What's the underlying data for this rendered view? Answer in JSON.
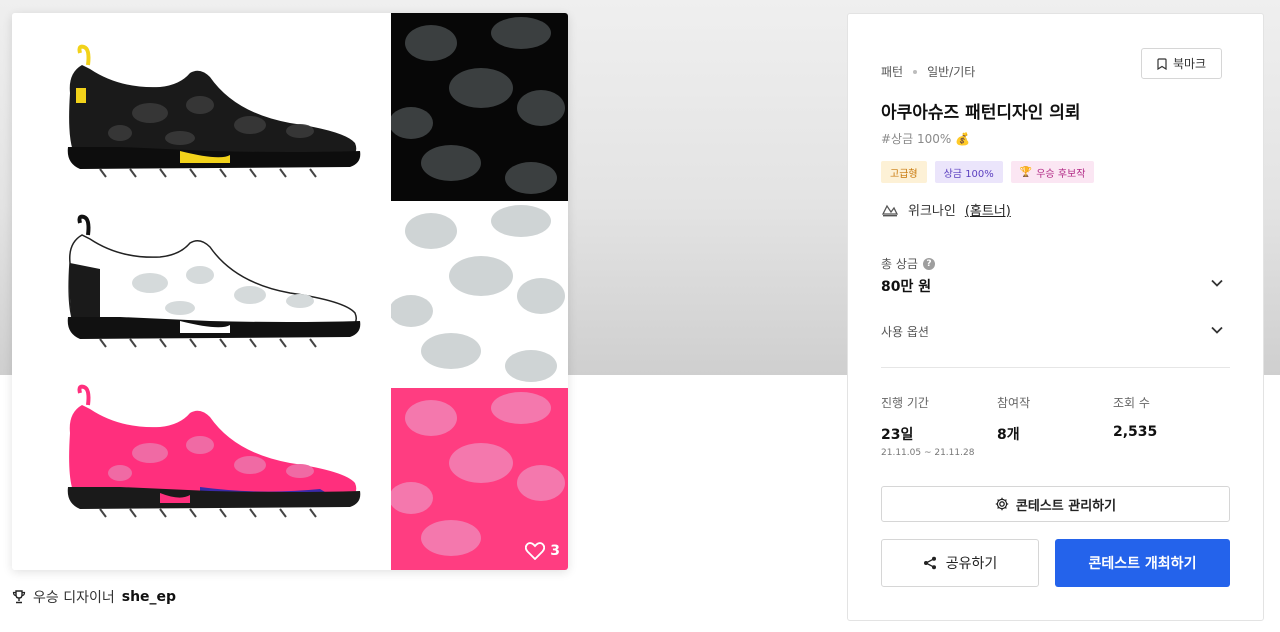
{
  "panel": {
    "category": {
      "main": "패턴",
      "sub": "일반/기타"
    },
    "bookmark_label": "북마크",
    "title": "아쿠아슈즈 패턴디자인 의뢰",
    "prize_tag": "#상금 100% 💰",
    "badges": {
      "grade": "고급형",
      "prize": "상금 100%",
      "candidate": "우승 후보작"
    },
    "host": {
      "name": "위크나인",
      "link": "(홈트너)"
    },
    "total_prize": {
      "label": "총 상금",
      "value": "80만 원"
    },
    "usage_option_label": "사용 옵션",
    "stats": {
      "period": {
        "label": "진행 기간",
        "value": "23일",
        "range": "21.11.05 ~ 21.11.28"
      },
      "entries": {
        "label": "참여작",
        "value": "8개"
      },
      "views": {
        "label": "조회 수",
        "value": "2,535"
      }
    },
    "manage_label": "콘테스트 관리하기",
    "share_label": "공유하기",
    "host_contest_label": "콘테스트 개최하기"
  },
  "image": {
    "likes": "3"
  },
  "winner": {
    "label": "우승 디자이너",
    "name": "she_ep"
  },
  "colors": {
    "primary": "#2463eb",
    "black": "#111111",
    "white": "#ffffff",
    "pink": "#ff2f7d"
  }
}
